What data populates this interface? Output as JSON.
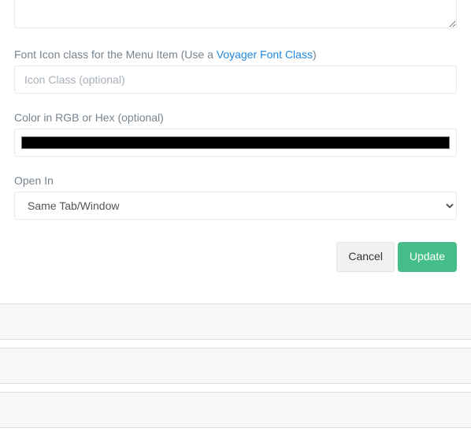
{
  "iconClass": {
    "labelPrefix": "Font Icon class for the Menu Item (Use a ",
    "linkText": "Voyager Font Class",
    "labelSuffix": ")",
    "placeholder": "Icon Class (optional)",
    "value": ""
  },
  "color": {
    "label": "Color in RGB or Hex (optional)",
    "value": "#000000"
  },
  "openIn": {
    "label": "Open In",
    "selected": "Same Tab/Window",
    "options": [
      "Same Tab/Window"
    ]
  },
  "buttons": {
    "cancel": "Cancel",
    "update": "Update"
  }
}
